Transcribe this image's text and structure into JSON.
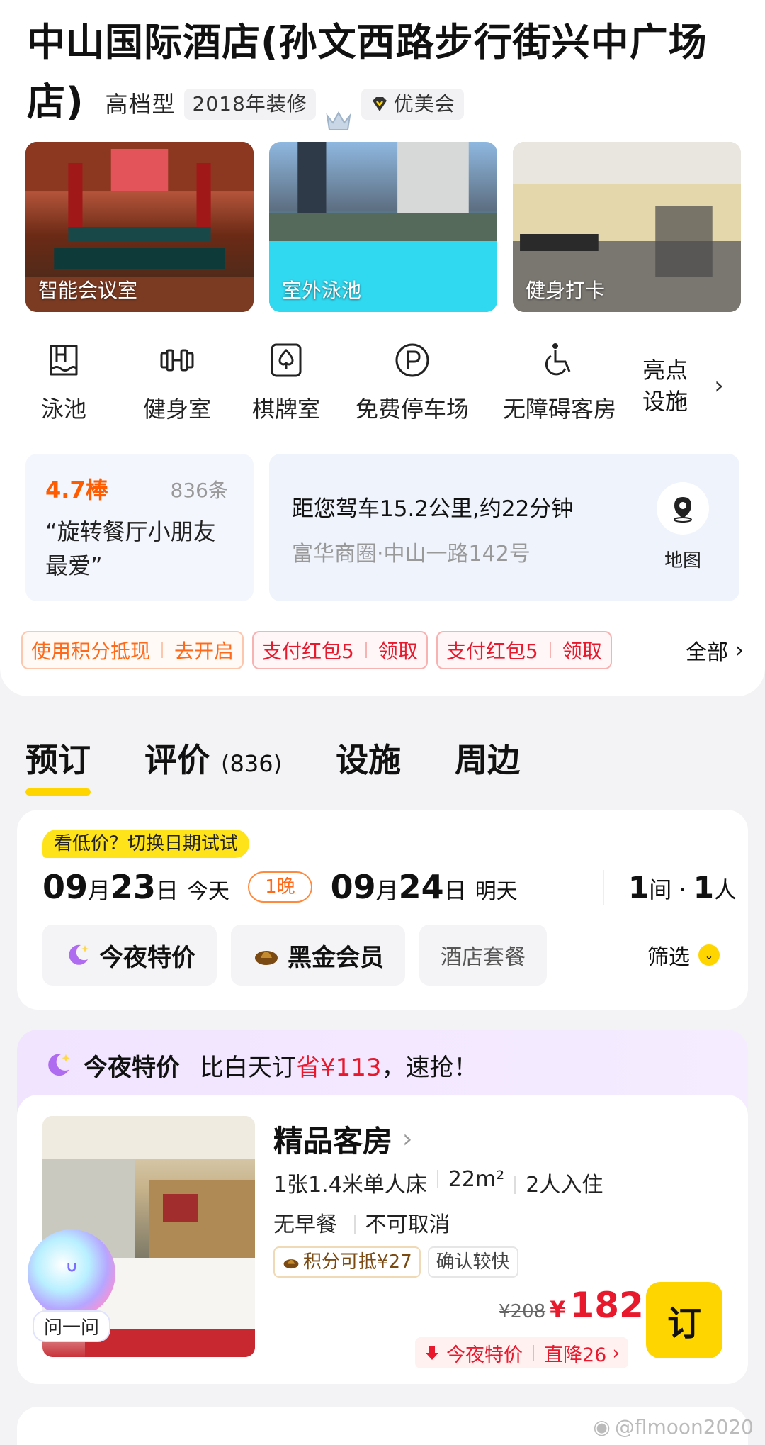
{
  "hotel": {
    "name": "中山国际酒店(孙文西路步行街兴中广场店)",
    "grade": "高档型",
    "renovation": "2018年装修",
    "member": "优美会"
  },
  "photos": [
    {
      "caption": "智能会议室"
    },
    {
      "caption": "室外泳池"
    },
    {
      "caption": "健身打卡"
    }
  ],
  "facilities": [
    {
      "label": "泳池",
      "icon": "pool-icon"
    },
    {
      "label": "健身室",
      "icon": "dumbbell-icon"
    },
    {
      "label": "棋牌室",
      "icon": "spade-card-icon"
    },
    {
      "label": "免费停车场",
      "icon": "parking-icon"
    },
    {
      "label": "无障碍客房",
      "icon": "wheelchair-icon"
    }
  ],
  "facilities_more": {
    "line1": "亮点",
    "line2": "设施"
  },
  "review": {
    "score": "4.7棒",
    "count": "836条",
    "quote": "“旋转餐厅小朋友最爱”"
  },
  "location": {
    "distance": "距您驾车15.2公里,约22分钟",
    "address": "富华商圈·中山一路142号",
    "map_label": "地图"
  },
  "coupons": [
    {
      "left": "使用积分抵现",
      "right": "去开启",
      "style": "orange"
    },
    {
      "left": "支付红包5",
      "right": "领取",
      "style": "red"
    },
    {
      "left": "支付红包5",
      "right": "领取",
      "style": "red"
    }
  ],
  "coupons_all": "全部",
  "tabs": [
    {
      "label": "预订",
      "count": ""
    },
    {
      "label": "评价",
      "count": "(836)"
    },
    {
      "label": "设施",
      "count": ""
    },
    {
      "label": "周边",
      "count": ""
    }
  ],
  "booking": {
    "low_price_tip": "看低价？切换日期试试",
    "checkin": {
      "month": "09",
      "month_unit": "月",
      "day": "23",
      "day_unit": "日",
      "note": "今天"
    },
    "nights": "1晚",
    "checkout": {
      "month": "09",
      "month_unit": "月",
      "day": "24",
      "day_unit": "日",
      "note": "明天"
    },
    "rooms_num": "1",
    "rooms_unit": "间 · ",
    "guests_num": "1",
    "guests_unit": "人",
    "filters": [
      "今夜特价",
      "黑金会员",
      "酒店套餐"
    ],
    "filter_label": "筛选"
  },
  "deal": {
    "title": "今夜特价",
    "desc_prefix": "比白天订",
    "save": "省¥113",
    "desc_suffix": "，速抢！"
  },
  "room": {
    "name": "精品客房",
    "bed": "1张1.4米单人床",
    "area": "22m²",
    "occupancy": "2人入住",
    "breakfast": "无早餐",
    "cancel": "不可取消",
    "tags": [
      "积分可抵¥27",
      "确认较快"
    ],
    "old_price": "¥208",
    "currency": "¥",
    "price": "182",
    "discount_label": "今夜特价",
    "discount_amount": "直降26",
    "book": "订"
  },
  "assistant": {
    "label": "问一问"
  },
  "watermark": "@flmoon2020",
  "colors": {
    "accent": "#ffd500",
    "price": "#e8182d",
    "orange": "#ff6a1a",
    "deal_bg": "#f1e4ff"
  }
}
